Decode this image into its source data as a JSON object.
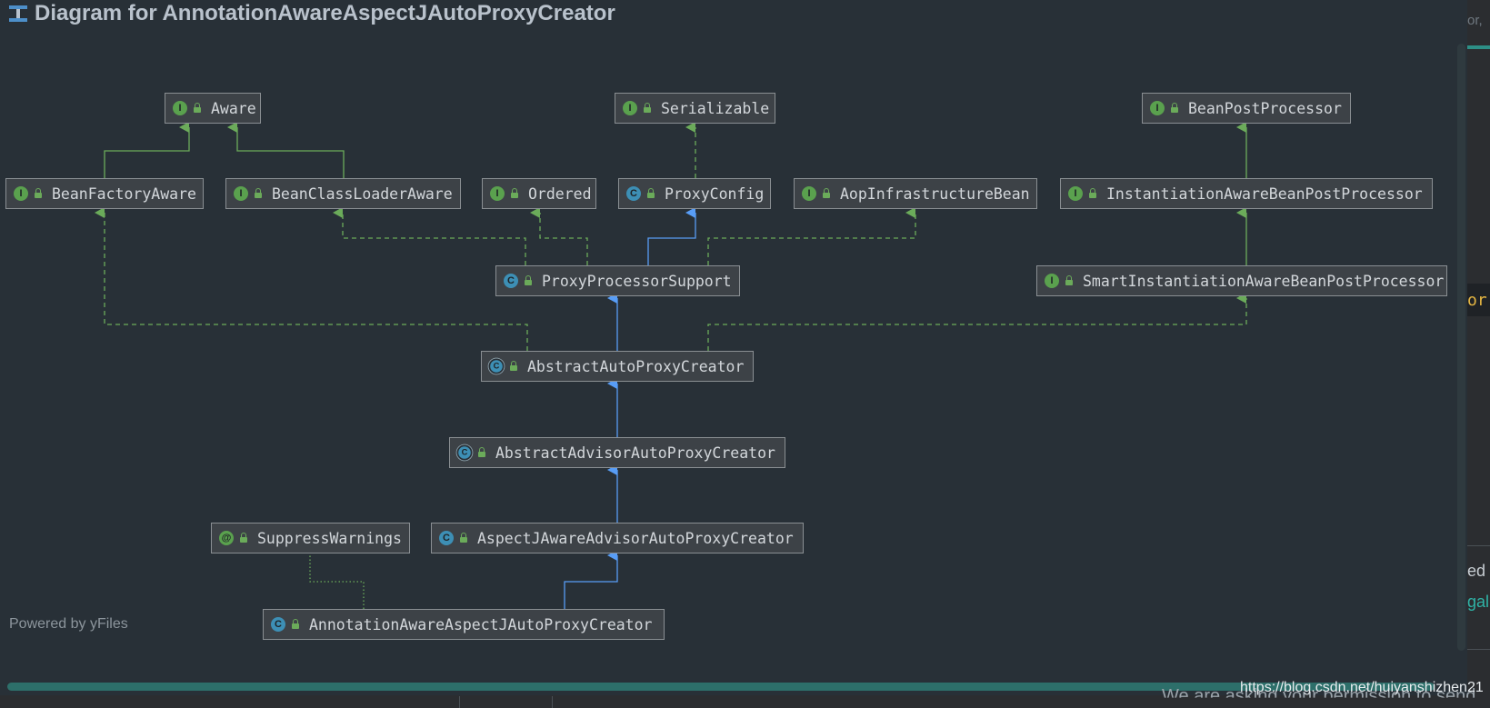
{
  "title": "Diagram for AnnotationAwareAspectJAutoProxyCreator",
  "powered_by": "Powered by yFiles",
  "colors": {
    "background": "#283037",
    "node_fill": "#3d4247",
    "interface_badge": "#5aa14e",
    "class_badge": "#3d8fb5",
    "extends_edge": "#589df6",
    "implements_edge": "#6bab5a"
  },
  "nodes": [
    {
      "id": "Aware",
      "kind": "interface",
      "badge": "I",
      "label": "Aware"
    },
    {
      "id": "Serializable",
      "kind": "interface",
      "badge": "I",
      "label": "Serializable"
    },
    {
      "id": "BeanPostProcessor",
      "kind": "interface",
      "badge": "I",
      "label": "BeanPostProcessor"
    },
    {
      "id": "BeanFactoryAware",
      "kind": "interface",
      "badge": "I",
      "label": "BeanFactoryAware"
    },
    {
      "id": "BeanClassLoaderAware",
      "kind": "interface",
      "badge": "I",
      "label": "BeanClassLoaderAware"
    },
    {
      "id": "Ordered",
      "kind": "interface",
      "badge": "I",
      "label": "Ordered"
    },
    {
      "id": "ProxyConfig",
      "kind": "class",
      "badge": "C",
      "label": "ProxyConfig"
    },
    {
      "id": "AopInfrastructureBean",
      "kind": "interface",
      "badge": "I",
      "label": "AopInfrastructureBean"
    },
    {
      "id": "InstantiationAwareBeanPostProcessor",
      "kind": "interface",
      "badge": "I",
      "label": "InstantiationAwareBeanPostProcessor"
    },
    {
      "id": "ProxyProcessorSupport",
      "kind": "class",
      "badge": "C",
      "label": "ProxyProcessorSupport"
    },
    {
      "id": "SmartInstantiationAwareBeanPostProcessor",
      "kind": "interface",
      "badge": "I",
      "label": "SmartInstantiationAwareBeanPostProcessor"
    },
    {
      "id": "AbstractAutoProxyCreator",
      "kind": "abstract",
      "badge": "C",
      "label": "AbstractAutoProxyCreator"
    },
    {
      "id": "AbstractAdvisorAutoProxyCreator",
      "kind": "abstract",
      "badge": "C",
      "label": "AbstractAdvisorAutoProxyCreator"
    },
    {
      "id": "SuppressWarnings",
      "kind": "annotation",
      "badge": "@",
      "label": "SuppressWarnings"
    },
    {
      "id": "AspectJAwareAdvisorAutoProxyCreator",
      "kind": "class",
      "badge": "C",
      "label": "AspectJAwareAdvisorAutoProxyCreator"
    },
    {
      "id": "AnnotationAwareAspectJAutoProxyCreator",
      "kind": "class",
      "badge": "C",
      "label": "AnnotationAwareAspectJAutoProxyCreator"
    }
  ],
  "edges": [
    {
      "from": "BeanFactoryAware",
      "to": "Aware",
      "type": "extends-interface"
    },
    {
      "from": "BeanClassLoaderAware",
      "to": "Aware",
      "type": "extends-interface"
    },
    {
      "from": "ProxyConfig",
      "to": "Serializable",
      "type": "implements"
    },
    {
      "from": "InstantiationAwareBeanPostProcessor",
      "to": "BeanPostProcessor",
      "type": "extends-interface"
    },
    {
      "from": "SmartInstantiationAwareBeanPostProcessor",
      "to": "InstantiationAwareBeanPostProcessor",
      "type": "extends-interface"
    },
    {
      "from": "ProxyProcessorSupport",
      "to": "ProxyConfig",
      "type": "extends"
    },
    {
      "from": "ProxyProcessorSupport",
      "to": "BeanClassLoaderAware",
      "type": "implements"
    },
    {
      "from": "ProxyProcessorSupport",
      "to": "Ordered",
      "type": "implements"
    },
    {
      "from": "ProxyProcessorSupport",
      "to": "AopInfrastructureBean",
      "type": "implements"
    },
    {
      "from": "AbstractAutoProxyCreator",
      "to": "ProxyProcessorSupport",
      "type": "extends"
    },
    {
      "from": "AbstractAutoProxyCreator",
      "to": "BeanFactoryAware",
      "type": "implements"
    },
    {
      "from": "AbstractAutoProxyCreator",
      "to": "SmartInstantiationAwareBeanPostProcessor",
      "type": "implements"
    },
    {
      "from": "AbstractAdvisorAutoProxyCreator",
      "to": "AbstractAutoProxyCreator",
      "type": "extends"
    },
    {
      "from": "AspectJAwareAdvisorAutoProxyCreator",
      "to": "AbstractAdvisorAutoProxyCreator",
      "type": "extends"
    },
    {
      "from": "AnnotationAwareAspectJAutoProxyCreator",
      "to": "AspectJAwareAdvisorAutoProxyCreator",
      "type": "extends"
    },
    {
      "from": "AnnotationAwareAspectJAutoProxyCreator",
      "to": "SuppressWarnings",
      "type": "annotated"
    }
  ],
  "right_panel_fragments": [
    "or,",
    "or",
    "ed t",
    "gal"
  ],
  "bottom_text": "We are asking your permission to send",
  "watermark": "https://blog.csdn.net/huiyanshizhen21"
}
